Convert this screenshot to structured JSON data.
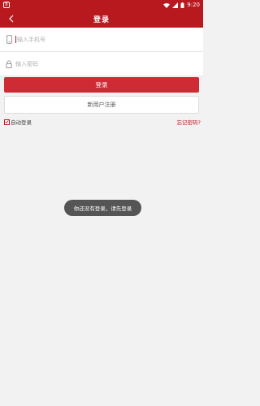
{
  "status_bar": {
    "time": "9:20",
    "app_badge": "B"
  },
  "header": {
    "title": "登录"
  },
  "form": {
    "phone_placeholder": "输入手机号",
    "password_placeholder": "输入密码"
  },
  "buttons": {
    "login_label": "登录",
    "register_label": "新用户注册"
  },
  "options": {
    "auto_login_label": "自动登录",
    "auto_login_checked": true,
    "forgot_password_label": "忘记密码?"
  },
  "toast": {
    "message": "你还没有登录，请先登录"
  },
  "colors": {
    "brand": "#b7191f",
    "login_button": "#cf2b34",
    "background": "#f2f2f2"
  }
}
